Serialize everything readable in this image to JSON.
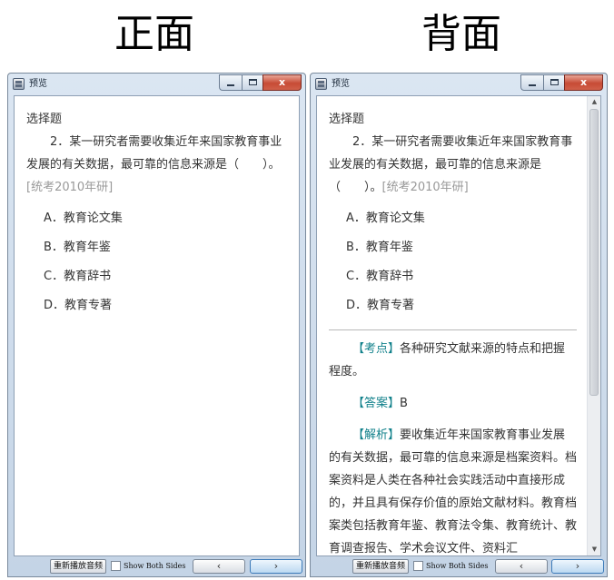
{
  "headings": {
    "front": "正面",
    "back": "背面"
  },
  "window": {
    "title": "预览",
    "close_glyph": "x"
  },
  "card": {
    "question_type": "选择题",
    "stem": "2．某一研究者需要收集近年来国家教育事业发展的有关数据，最可靠的信息来源是（　　）。",
    "source": "[统考2010年研]",
    "options": [
      "A．教育论文集",
      "B．教育年鉴",
      "C．教育辞书",
      "D．教育专著"
    ]
  },
  "answer": {
    "kaodian_tag": "【考点】",
    "kaodian_text": "各种研究文献来源的特点和把握程度。",
    "daan_tag": "【答案】",
    "daan_text": "B",
    "jiexi_tag": "【解析】",
    "jiexi_text": "要收集近年来国家教育事业发展的有关数据，最可靠的信息来源是档案资料。档案资料是人类在各种社会实践活动中直接形成的，并且具有保存价值的原始文献材料。教育档案类包括教育年鉴、教育法令集、教育统计、教育调查报告、学术会议文件、资料汇"
  },
  "bottom": {
    "replay_label": "重新播放音频",
    "show_both_sides_label": "Show Both Sides",
    "prev_glyph": "‹",
    "next_glyph": "›"
  },
  "scrollbar": {
    "up_glyph": "▲",
    "down_glyph": "▼"
  }
}
